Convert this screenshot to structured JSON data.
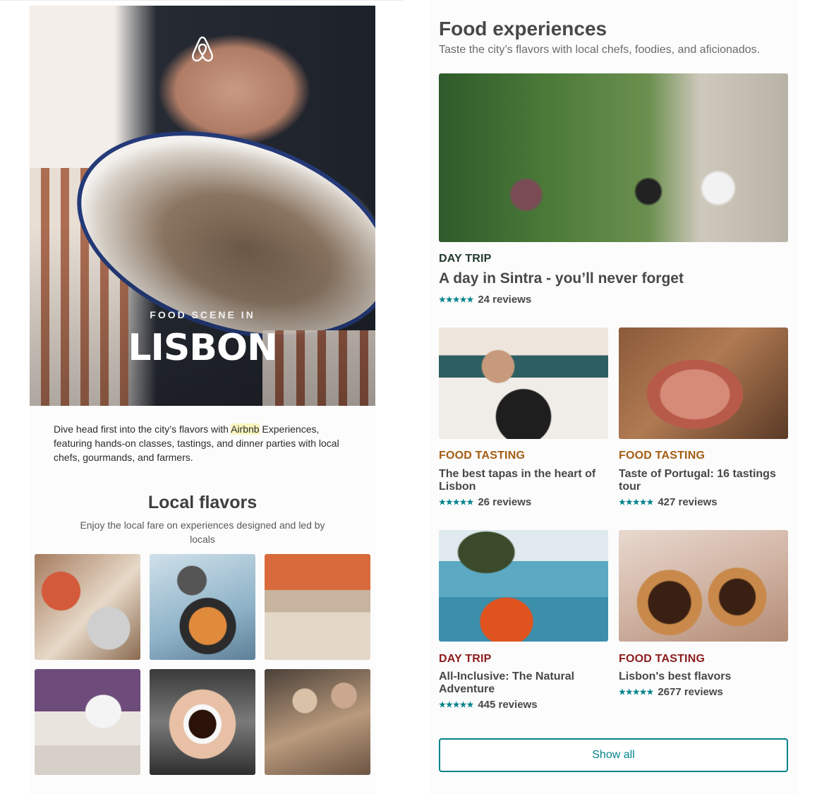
{
  "hero": {
    "logo": "airbnb-logo-icon",
    "kicker": "FOOD SCENE IN",
    "city": "LISBON"
  },
  "intro": {
    "before": "Dive head first into the city’s flavors with ",
    "highlight": "Airbnb",
    "after": " Experiences, featuring hands-on classes, tastings, and dinner parties with local chefs, gourmands, and farmers."
  },
  "local_flavors": {
    "title": "Local flavors",
    "subtitle": "Enjoy the local fare on experiences designed and led by locals"
  },
  "food_experiences": {
    "title": "Food experiences",
    "subtitle": "Taste the city’s flavors with local chefs, foodies, and aficionados.",
    "featured": {
      "tag": "DAY TRIP",
      "title": "A day in Sintra - you’ll never forget",
      "stars": "★★★★★",
      "reviews": "24 reviews"
    },
    "cards": [
      {
        "tag": "FOOD TASTING",
        "title": "The best tapas in the heart of Lisbon",
        "stars": "★★★★★",
        "reviews": "26 reviews"
      },
      {
        "tag": "FOOD TASTING",
        "title": "Taste of Portugal: 16 tastings tour",
        "stars": "★★★★★",
        "reviews": "427 reviews"
      },
      {
        "tag": "DAY TRIP",
        "title": "All-Inclusive: The Natural Adventure",
        "stars": "★★★★★",
        "reviews": "445 reviews"
      },
      {
        "tag": "FOOD TASTING",
        "title": "Lisbon's best flavors",
        "stars": "★★★★★",
        "reviews": "2677 reviews"
      }
    ],
    "show_all_label": "Show all"
  },
  "colors": {
    "teal": "#00838a",
    "tag_green": "#223a2a",
    "tag_orange": "#a55d12",
    "tag_red": "#8c1c1c",
    "text": "#484848"
  }
}
